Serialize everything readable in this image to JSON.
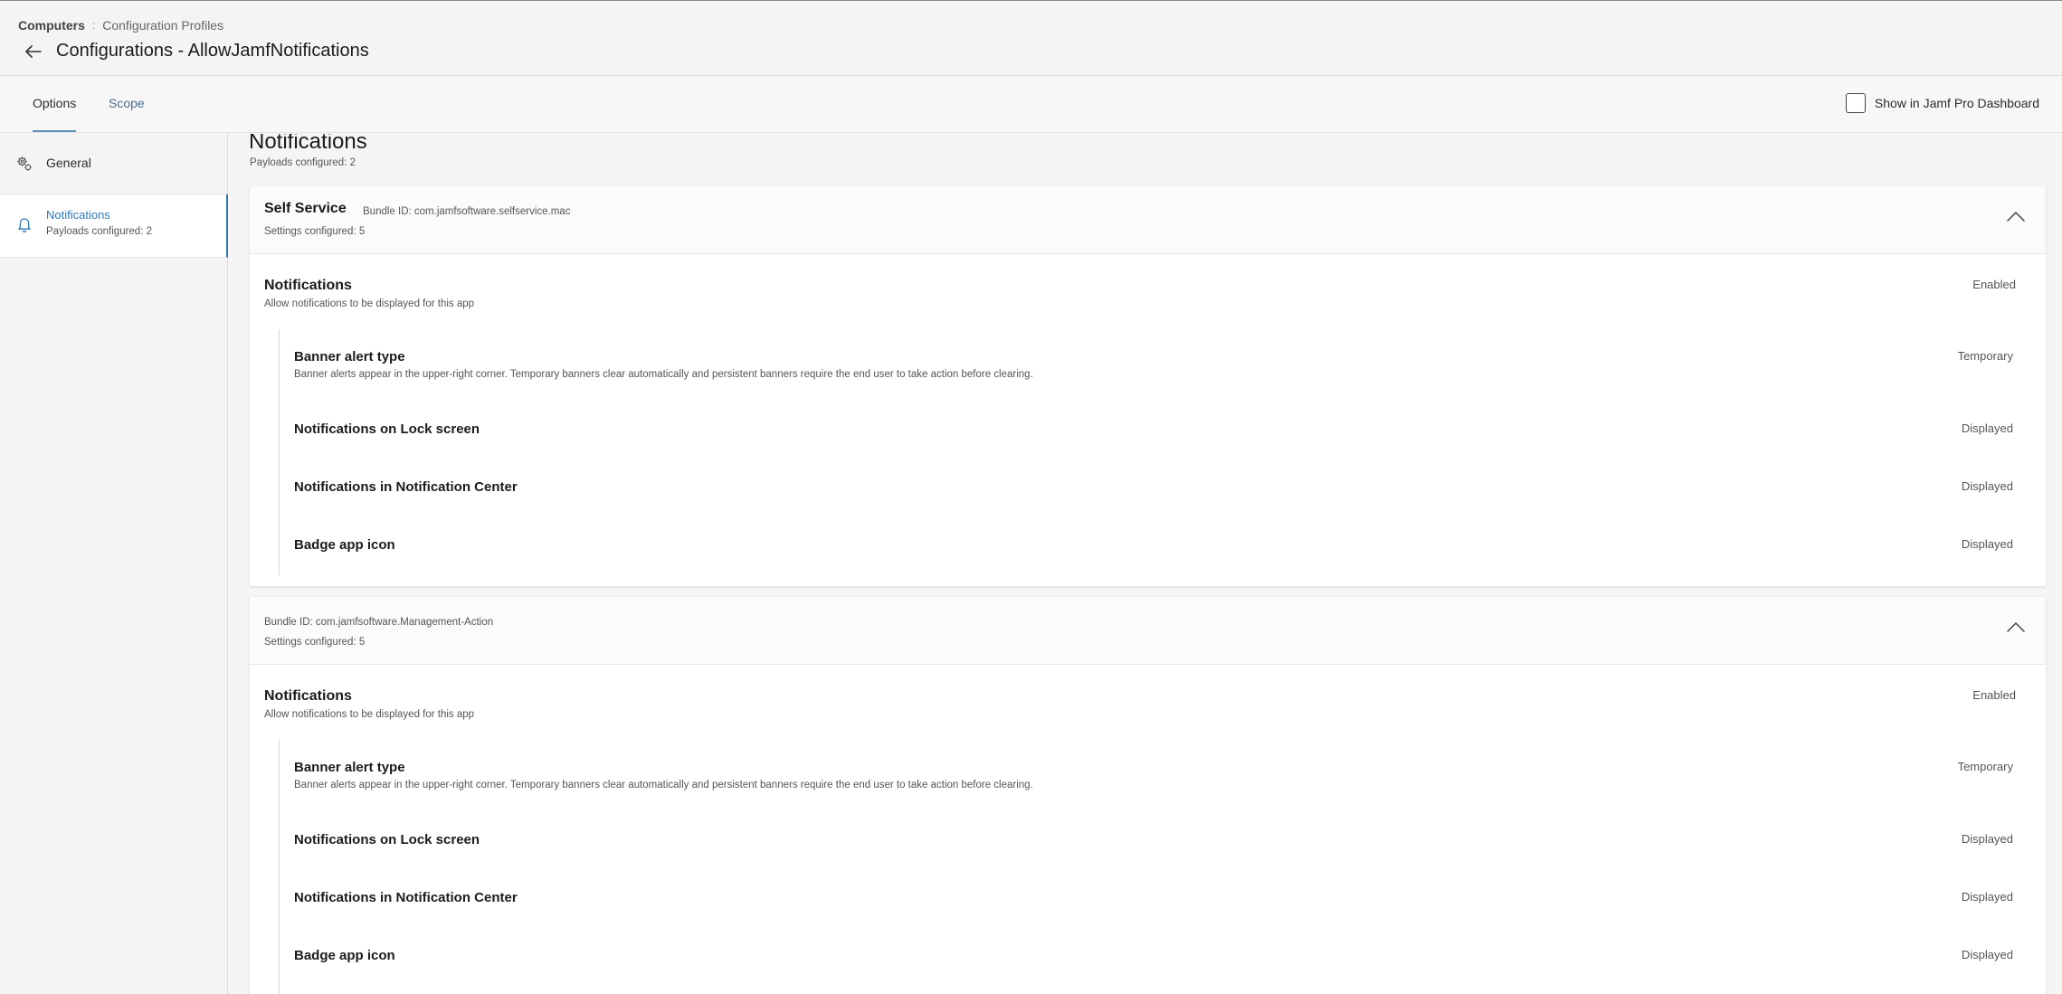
{
  "header": {
    "breadcrumb_root": "Computers",
    "breadcrumb_sep": ":",
    "breadcrumb_leaf": "Configuration Profiles",
    "title": "Configurations - AllowJamfNotifications"
  },
  "tabs": {
    "options": "Options",
    "scope": "Scope",
    "active": "Options"
  },
  "dashboard_toggle": {
    "label": "Show in Jamf Pro Dashboard",
    "checked": false
  },
  "sidebar": {
    "items": [
      {
        "label": "General",
        "icon": "gears-icon"
      },
      {
        "label": "Notifications",
        "sub": "Payloads configured: 2",
        "icon": "bell-icon",
        "selected": true
      }
    ]
  },
  "main": {
    "title": "Notifications",
    "subtitle": "Payloads configured: 2",
    "payloads": [
      {
        "app_name": "Self Service",
        "bundle": "Bundle ID: com.jamfsoftware.selfservice.mac",
        "settings": "Settings configured: 5",
        "notifications": {
          "title": "Notifications",
          "desc": "Allow notifications to be displayed for this app",
          "value": "Enabled"
        },
        "subs": [
          {
            "title": "Banner alert type",
            "desc": "Banner alerts appear in the upper-right corner. Temporary banners clear automatically and persistent banners require the end user to take action before clearing.",
            "value": "Temporary"
          },
          {
            "title": "Notifications on Lock screen",
            "value": "Displayed"
          },
          {
            "title": "Notifications in Notification Center",
            "value": "Displayed"
          },
          {
            "title": "Badge app icon",
            "value": "Displayed"
          }
        ]
      },
      {
        "app_name": "",
        "bundle": "Bundle ID: com.jamfsoftware.Management-Action",
        "settings": "Settings configured: 5",
        "notifications": {
          "title": "Notifications",
          "desc": "Allow notifications to be displayed for this app",
          "value": "Enabled"
        },
        "subs": [
          {
            "title": "Banner alert type",
            "desc": "Banner alerts appear in the upper-right corner. Temporary banners clear automatically and persistent banners require the end user to take action before clearing.",
            "value": "Temporary"
          },
          {
            "title": "Notifications on Lock screen",
            "value": "Displayed"
          },
          {
            "title": "Notifications in Notification Center",
            "value": "Displayed"
          },
          {
            "title": "Badge app icon",
            "value": "Displayed"
          }
        ]
      }
    ]
  },
  "colors": {
    "accent": "#2d79b8",
    "tab_inactive": "#4b6e8a"
  }
}
